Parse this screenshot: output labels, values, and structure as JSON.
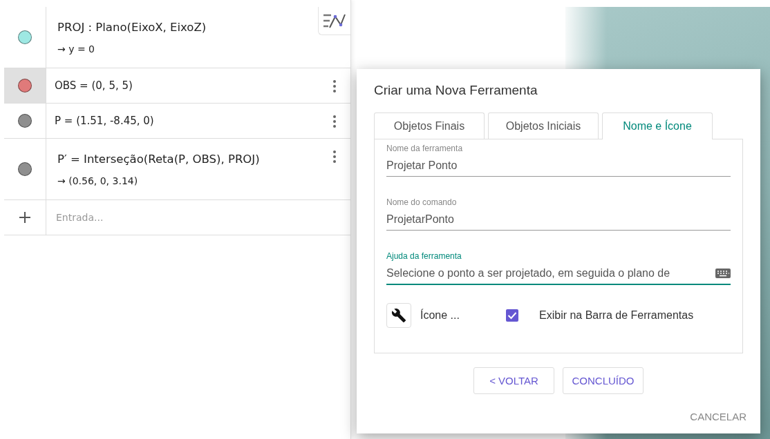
{
  "algebra": {
    "items": [
      {
        "definition": "PROJ : Plano(EixoX, EixoZ)",
        "value": "→ y = 0",
        "color": "#9ee8e3",
        "selected": false
      },
      {
        "definition": "OBS = (0, 5, 5)",
        "color": "#e07a7a",
        "selected": true,
        "menu": true
      },
      {
        "definition": "P = (1.51, -8.45, 0)",
        "color": "#8f8f8f",
        "selected": false,
        "menu": true
      },
      {
        "definition": "P′ = Interseção(Reta(P, OBS), PROJ)",
        "value": "→ (0.56, 0, 3.14)",
        "color": "#8f8f8f",
        "selected": false,
        "menu": true
      }
    ],
    "input": {
      "placeholder": "Entrada..."
    }
  },
  "dialog": {
    "title": "Criar uma Nova Ferramenta",
    "tabs": [
      {
        "label": "Objetos Finais",
        "selected": false
      },
      {
        "label": "Objetos Iniciais",
        "selected": false
      },
      {
        "label": "Nome e Ícone",
        "selected": true
      }
    ],
    "fields": [
      {
        "label": "Nome da ferramenta",
        "value": "Projetar Ponto",
        "focused": false
      },
      {
        "label": "Nome do comando",
        "value": "ProjetarPonto",
        "focused": false
      },
      {
        "label": "Ajuda da ferramenta",
        "value": "Selecione o ponto a ser projetado, em seguida o plano de",
        "focused": true
      }
    ],
    "icon_label": "Ícone ...",
    "show_in_toolbar": {
      "label": "Exibir na Barra de Ferramentas",
      "checked": true
    },
    "buttons": [
      "< VOLTAR",
      "CONCLUÍDO"
    ],
    "cancel": "CANCELAR"
  }
}
